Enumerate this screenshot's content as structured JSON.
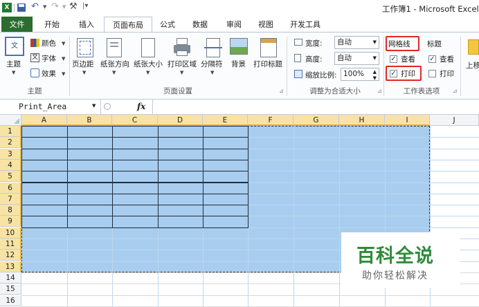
{
  "titlebar": {
    "title": "工作簿1 - Microsoft Excel",
    "colors": {
      "excel_green": "#1e7b34"
    }
  },
  "tabs": [
    {
      "label": "文件"
    },
    {
      "label": "开始"
    },
    {
      "label": "插入"
    },
    {
      "label": "页面布局"
    },
    {
      "label": "公式"
    },
    {
      "label": "数据"
    },
    {
      "label": "审阅"
    },
    {
      "label": "视图"
    },
    {
      "label": "开发工具"
    }
  ],
  "ribbon": {
    "themes": {
      "theme_label": "主题",
      "colors_label": "颜色",
      "fonts_label": "字体",
      "effects_label": "效果",
      "group_label": "主题"
    },
    "page_setup": {
      "margins_label": "页边距",
      "orientation_label": "纸张方向",
      "size_label": "纸张大小",
      "print_area_label": "打印区域",
      "breaks_label": "分隔符",
      "background_label": "背景",
      "print_titles_label": "打印标题",
      "group_label": "页面设置"
    },
    "scale": {
      "width_label": "宽度:",
      "width_value": "自动",
      "height_label": "高度:",
      "height_value": "自动",
      "scale_label": "缩放比例:",
      "scale_value": "100%",
      "group_label": "调整为合适大小"
    },
    "sheet_options": {
      "gridlines_label": "网格线",
      "headings_label": "标题",
      "view_label": "查看",
      "print_label": "打印",
      "gridlines_view_checked": true,
      "gridlines_print_checked": true,
      "headings_view_checked": true,
      "headings_print_checked": false,
      "group_label": "工作表选项"
    },
    "arrange": {
      "bring_forward_label": "上移"
    }
  },
  "formula_bar": {
    "name_box": "Print_Area",
    "fx": "fx",
    "formula": ""
  },
  "sheet": {
    "columns": [
      "A",
      "B",
      "C",
      "D",
      "E",
      "F",
      "G",
      "H",
      "I",
      "J"
    ],
    "rows": [
      "1",
      "2",
      "3",
      "4",
      "5",
      "6",
      "7",
      "8",
      "9",
      "10",
      "11",
      "12",
      "13",
      "14",
      "15",
      "16"
    ],
    "selection_color": "#a8cdef"
  },
  "watermark": {
    "title": "百科全说",
    "subtitle": "助你轻松解决",
    "title_color": "#2e8b3a"
  }
}
